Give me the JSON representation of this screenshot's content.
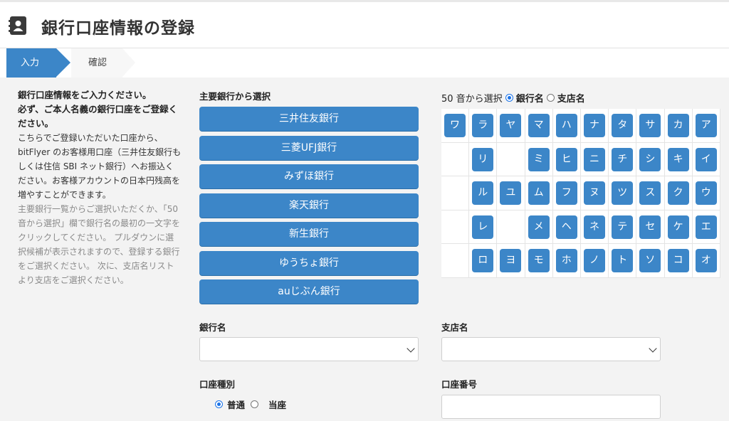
{
  "header": {
    "title": "銀行口座情報の登録"
  },
  "steps": {
    "current": "入力",
    "next": "確認"
  },
  "description": {
    "bold1": "銀行口座情報をご入力ください。",
    "bold2": "必ず、ご本人名義の銀行口座をご登録ください。",
    "normal": "こちらでご登録いただいた口座から、bitFlyer のお客様用口座（三井住友銀行もしくは住信 SBI ネット銀行）へお振込ください。お客様アカウントの日本円残高を増やすことができます。",
    "gray": "主要銀行一覧からご選択いただくか、「50 音から選択」欄で銀行名の最初の一文字をクリックしてください。 プルダウンに選択候補が表示されますので、登録する銀行をご選択ください。 次に、支店名リストより支店をご選択ください。"
  },
  "major_banks": {
    "label": "主要銀行から選択",
    "items": [
      "三井住友銀行",
      "三菱UFJ銀行",
      "みずほ銀行",
      "楽天銀行",
      "新生銀行",
      "ゆうちょ銀行",
      "auじぶん銀行"
    ]
  },
  "kana": {
    "label": "50 音から選択",
    "option_bank": "銀行名",
    "option_branch": "支店名",
    "selected": "銀行名",
    "rows": [
      [
        "ワ",
        "ラ",
        "ヤ",
        "マ",
        "ハ",
        "ナ",
        "タ",
        "サ",
        "カ",
        "ア"
      ],
      [
        "",
        "リ",
        "",
        "ミ",
        "ヒ",
        "ニ",
        "チ",
        "シ",
        "キ",
        "イ"
      ],
      [
        "",
        "ル",
        "ユ",
        "ム",
        "フ",
        "ヌ",
        "ツ",
        "ス",
        "ク",
        "ウ"
      ],
      [
        "",
        "レ",
        "",
        "メ",
        "ヘ",
        "ネ",
        "テ",
        "セ",
        "ケ",
        "エ"
      ],
      [
        "",
        "ロ",
        "ヨ",
        "モ",
        "ホ",
        "ノ",
        "ト",
        "ソ",
        "コ",
        "オ"
      ]
    ]
  },
  "form": {
    "bank_name_label": "銀行名",
    "branch_name_label": "支店名",
    "account_type_label": "口座種別",
    "account_number_label": "口座番号",
    "account_types": [
      "普通",
      "当座"
    ],
    "account_type_selected": "普通"
  }
}
